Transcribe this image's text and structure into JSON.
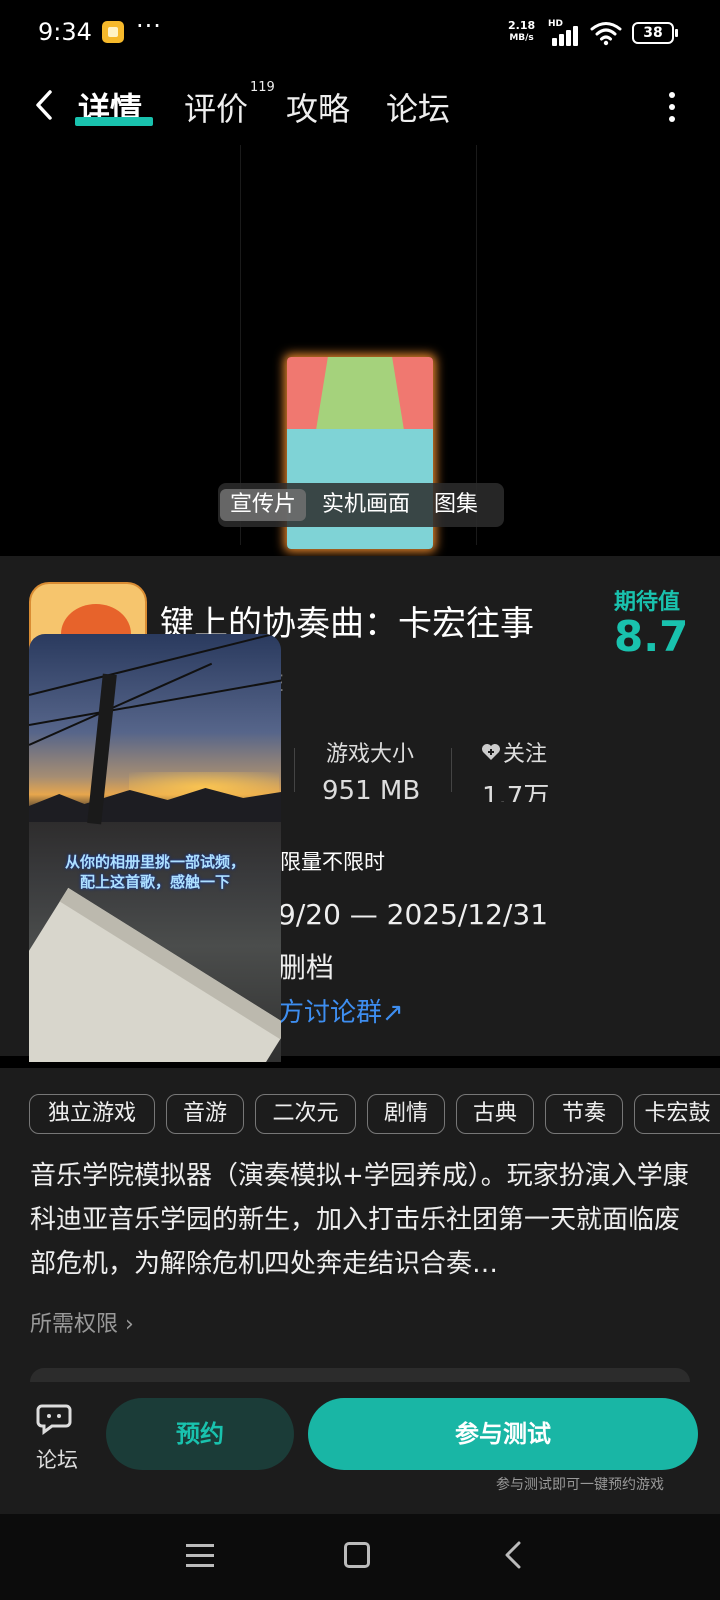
{
  "status_bar": {
    "time": "9:34",
    "more": "···",
    "net_speed_value": "2.18",
    "net_speed_unit": "MB/s",
    "hd": "HD",
    "battery": "38"
  },
  "top_nav": {
    "tabs": [
      {
        "label": "详情",
        "active": true
      },
      {
        "label": "评价",
        "count": "119"
      },
      {
        "label": "攻略"
      },
      {
        "label": "论坛"
      }
    ]
  },
  "media": {
    "tabs": [
      "宣传片",
      "实机画面",
      "图集"
    ],
    "active_tab": "宣传片"
  },
  "game": {
    "title": "键上的协奏曲：卡宏往事",
    "expect_label": "期待值",
    "expect_score": "8.7",
    "developer_fragment": "E",
    "stats": [
      {
        "label": "游戏大小",
        "value": "951 MB"
      },
      {
        "label": "关注",
        "value": "1.7万"
      }
    ],
    "test_limit": "限量不限时",
    "test_dates": "9/20 — 2025/12/31",
    "test_archive": "删档",
    "group_link": "方讨论群↗"
  },
  "floating_video": {
    "caption": "从你的相册里挑一部试频，配上这首歌，感触一下"
  },
  "tags": [
    "独立游戏",
    "音游",
    "二次元",
    "剧情",
    "古典",
    "节奏",
    "卡宏鼓"
  ],
  "description": "音乐学院模拟器（演奏模拟+学园养成）。玩家扮演入学康科迪亚音乐学园的新生，加入打击乐社团第一天就面临废部危机，为解除危机四处奔走结识合奏…",
  "permissions_link": "所需权限 ›",
  "action_bar": {
    "forum_label": "论坛",
    "reserve_label": "预约",
    "test_label": "参与测试",
    "test_hint": "参与测试即可一键预约游戏"
  },
  "colors": {
    "accent": "#19c2ae",
    "link": "#3e8ef0",
    "panel": "#1c1c1c"
  }
}
